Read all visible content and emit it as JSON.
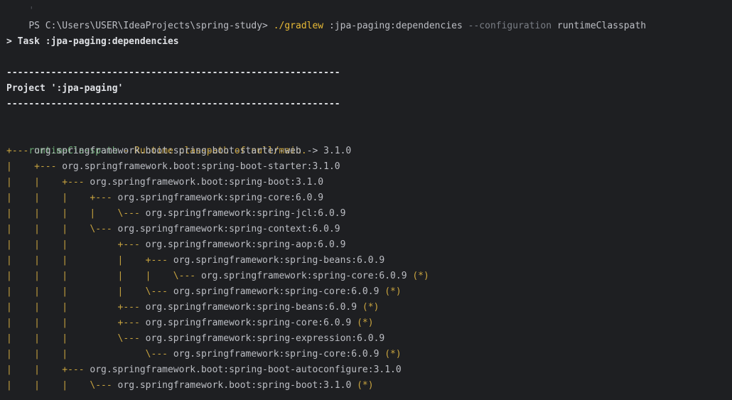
{
  "terminal": {
    "prompt_prefix": "PS C:\\Users\\USER\\IdeaProjects\\spring-study> ",
    "command": "./gradlew",
    "command_task": " :jpa-paging:dependencies ",
    "command_option": "--configuration",
    "command_value": " runtimeClasspath",
    "task_line": "> Task :jpa-paging:dependencies",
    "separator": "------------------------------------------------------------",
    "project_line": "Project ':jpa-paging'",
    "config_name": "runtimeClasspath",
    "config_desc": " - Runtime classpath of null/main.",
    "tree": [
      {
        "prefix": "+--- ",
        "dep": "org.springframework.boot:spring-boot-starter-web -> 3.1.0",
        "star": ""
      },
      {
        "prefix": "|    +--- ",
        "dep": "org.springframework.boot:spring-boot-starter:3.1.0",
        "star": ""
      },
      {
        "prefix": "|    |    +--- ",
        "dep": "org.springframework.boot:spring-boot:3.1.0",
        "star": ""
      },
      {
        "prefix": "|    |    |    +--- ",
        "dep": "org.springframework:spring-core:6.0.9",
        "star": ""
      },
      {
        "prefix": "|    |    |    |    \\--- ",
        "dep": "org.springframework:spring-jcl:6.0.9",
        "star": ""
      },
      {
        "prefix": "|    |    |    \\--- ",
        "dep": "org.springframework:spring-context:6.0.9",
        "star": ""
      },
      {
        "prefix": "|    |    |         +--- ",
        "dep": "org.springframework:spring-aop:6.0.9",
        "star": ""
      },
      {
        "prefix": "|    |    |         |    +--- ",
        "dep": "org.springframework:spring-beans:6.0.9",
        "star": ""
      },
      {
        "prefix": "|    |    |         |    |    \\--- ",
        "dep": "org.springframework:spring-core:6.0.9",
        "star": " (*)"
      },
      {
        "prefix": "|    |    |         |    \\--- ",
        "dep": "org.springframework:spring-core:6.0.9",
        "star": " (*)"
      },
      {
        "prefix": "|    |    |         +--- ",
        "dep": "org.springframework:spring-beans:6.0.9",
        "star": " (*)"
      },
      {
        "prefix": "|    |    |         +--- ",
        "dep": "org.springframework:spring-core:6.0.9",
        "star": " (*)"
      },
      {
        "prefix": "|    |    |         \\--- ",
        "dep": "org.springframework:spring-expression:6.0.9",
        "star": ""
      },
      {
        "prefix": "|    |    |              \\--- ",
        "dep": "org.springframework:spring-core:6.0.9",
        "star": " (*)"
      },
      {
        "prefix": "|    |    +--- ",
        "dep": "org.springframework.boot:spring-boot-autoconfigure:3.1.0",
        "star": ""
      },
      {
        "prefix": "|    |    |    \\--- ",
        "dep": "org.springframework.boot:spring-boot:3.1.0",
        "star": " (*)"
      }
    ]
  }
}
